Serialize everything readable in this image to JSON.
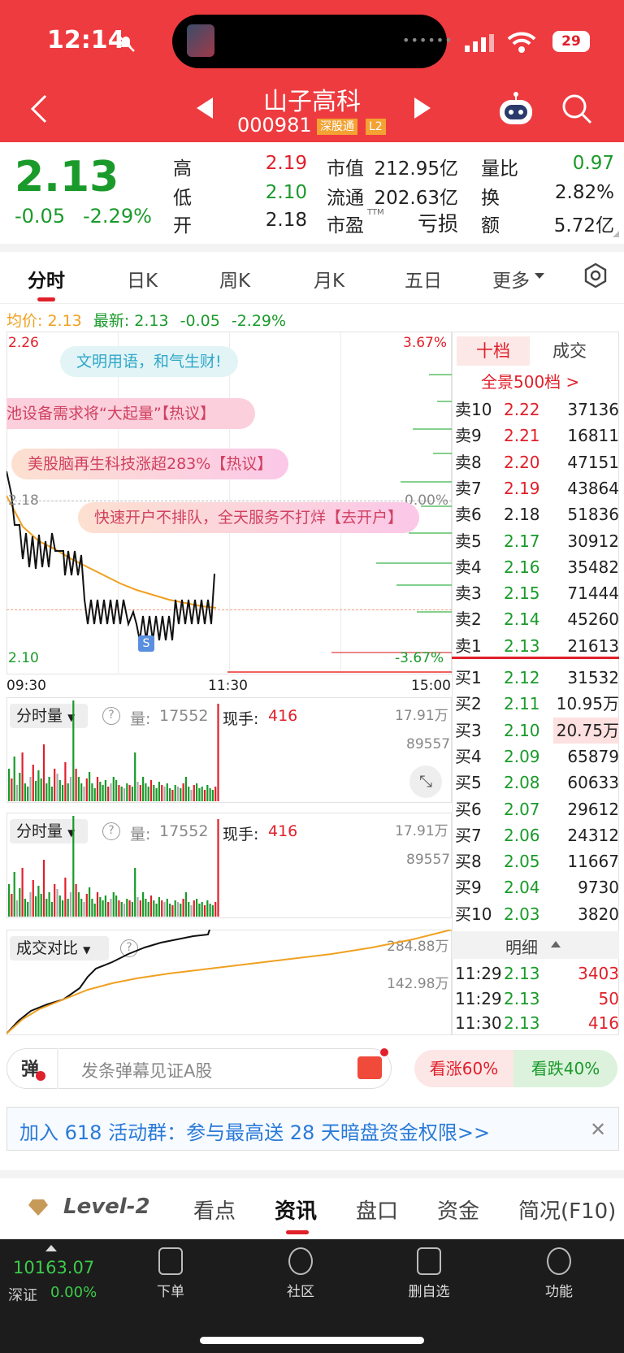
{
  "status_bar": {
    "time": "12:14",
    "battery": "29"
  },
  "header": {
    "name": "山子高科",
    "code": "000981",
    "tag1": "深股通",
    "tag2": "L2"
  },
  "quote": {
    "price": "2.13",
    "change": "-0.05",
    "change_pct": "-2.29%",
    "high_label": "高",
    "high": "2.19",
    "low_label": "低",
    "low": "2.10",
    "open_label": "开",
    "open": "2.18",
    "mcap_label": "市值",
    "mcap": "212.95亿",
    "float_label": "流通",
    "float": "202.63亿",
    "pe_label": "市盈",
    "pe_sup": "TTM",
    "pe": "亏损",
    "vr_label": "量比",
    "vr": "0.97",
    "turn_label": "换",
    "turn": "2.82%",
    "amt_label": "额",
    "amt": "5.72亿"
  },
  "tabs": [
    "分时",
    "日K",
    "周K",
    "月K",
    "五日",
    "更多"
  ],
  "chart": {
    "avg_label": "均价:",
    "avg": "2.13",
    "latest_label": "最新:",
    "latest": "2.13",
    "chg": "-0.05",
    "chg_pct": "-2.29%",
    "y_top": "2.26",
    "y_mid": "2.18",
    "y_bot": "2.10",
    "pct_top": "3.67%",
    "pct_mid": "0.00%",
    "pct_bot": "-3.67%",
    "t_start": "09:30",
    "t_mid": "11:30",
    "t_end": "15:00",
    "marker": "S"
  },
  "bubbles": [
    "文明用语，和气生财!",
    "池设备需求将“大起量”【热议】",
    "美股脑再生科技涨超283%【热议】",
    "快速开户不排队，全天服务不打烊【去开户】"
  ],
  "volume": {
    "selector": "分时量",
    "vol_label": "量:",
    "vol": "17552",
    "hand_label": "现手:",
    "hand": "416",
    "max": "17.91万",
    "mid": "89557"
  },
  "compare": {
    "selector": "成交对比",
    "max": "284.88万",
    "mid": "142.98万"
  },
  "orderbook": {
    "tab1": "十档",
    "tab2": "成交",
    "panorama": "全景500档 >",
    "asks": [
      {
        "n": "卖10",
        "p": "2.22",
        "v": "37136"
      },
      {
        "n": "卖9",
        "p": "2.21",
        "v": "16811"
      },
      {
        "n": "卖8",
        "p": "2.20",
        "v": "47151"
      },
      {
        "n": "卖7",
        "p": "2.19",
        "v": "43864"
      },
      {
        "n": "卖6",
        "p": "2.18",
        "v": "51836"
      },
      {
        "n": "卖5",
        "p": "2.17",
        "v": "30912"
      },
      {
        "n": "卖4",
        "p": "2.16",
        "v": "35482"
      },
      {
        "n": "卖3",
        "p": "2.15",
        "v": "71444"
      },
      {
        "n": "卖2",
        "p": "2.14",
        "v": "45260"
      },
      {
        "n": "卖1",
        "p": "2.13",
        "v": "21613"
      }
    ],
    "bids": [
      {
        "n": "买1",
        "p": "2.12",
        "v": "31532"
      },
      {
        "n": "买2",
        "p": "2.11",
        "v": "10.95万"
      },
      {
        "n": "买3",
        "p": "2.10",
        "v": "20.75万"
      },
      {
        "n": "买4",
        "p": "2.09",
        "v": "65879"
      },
      {
        "n": "买5",
        "p": "2.08",
        "v": "60633"
      },
      {
        "n": "买6",
        "p": "2.07",
        "v": "29612"
      },
      {
        "n": "买7",
        "p": "2.06",
        "v": "24312"
      },
      {
        "n": "买8",
        "p": "2.05",
        "v": "11667"
      },
      {
        "n": "买9",
        "p": "2.04",
        "v": "9730"
      },
      {
        "n": "买10",
        "p": "2.03",
        "v": "3820"
      }
    ],
    "detail_label": "明细",
    "trades": [
      {
        "t": "11:29",
        "p": "2.13",
        "v": "3403"
      },
      {
        "t": "11:29",
        "p": "2.13",
        "v": "50"
      },
      {
        "t": "11:30",
        "p": "2.13",
        "v": "416"
      }
    ]
  },
  "barrage": {
    "icon": "弹",
    "placeholder": "发条弹幕见证A股",
    "rise": "看涨60%",
    "fall": "看跌40%"
  },
  "banner": {
    "text": "加入 618 活动群：参与最高送 28 天暗盘资金权限>>"
  },
  "bottom_tabs": [
    "Level-2",
    "看点",
    "资讯",
    "盘口",
    "资金",
    "简况(F10)"
  ],
  "footer": {
    "index_value": "10163.07",
    "index_name": "深证",
    "index_pct": "0.00%",
    "buttons": [
      "下单",
      "社区",
      "删自选",
      "功能"
    ]
  },
  "colors": {
    "header": "#ee3b3f",
    "up": "#e0202a",
    "down": "#1a9a2a",
    "avg_line": "#f0a020"
  }
}
